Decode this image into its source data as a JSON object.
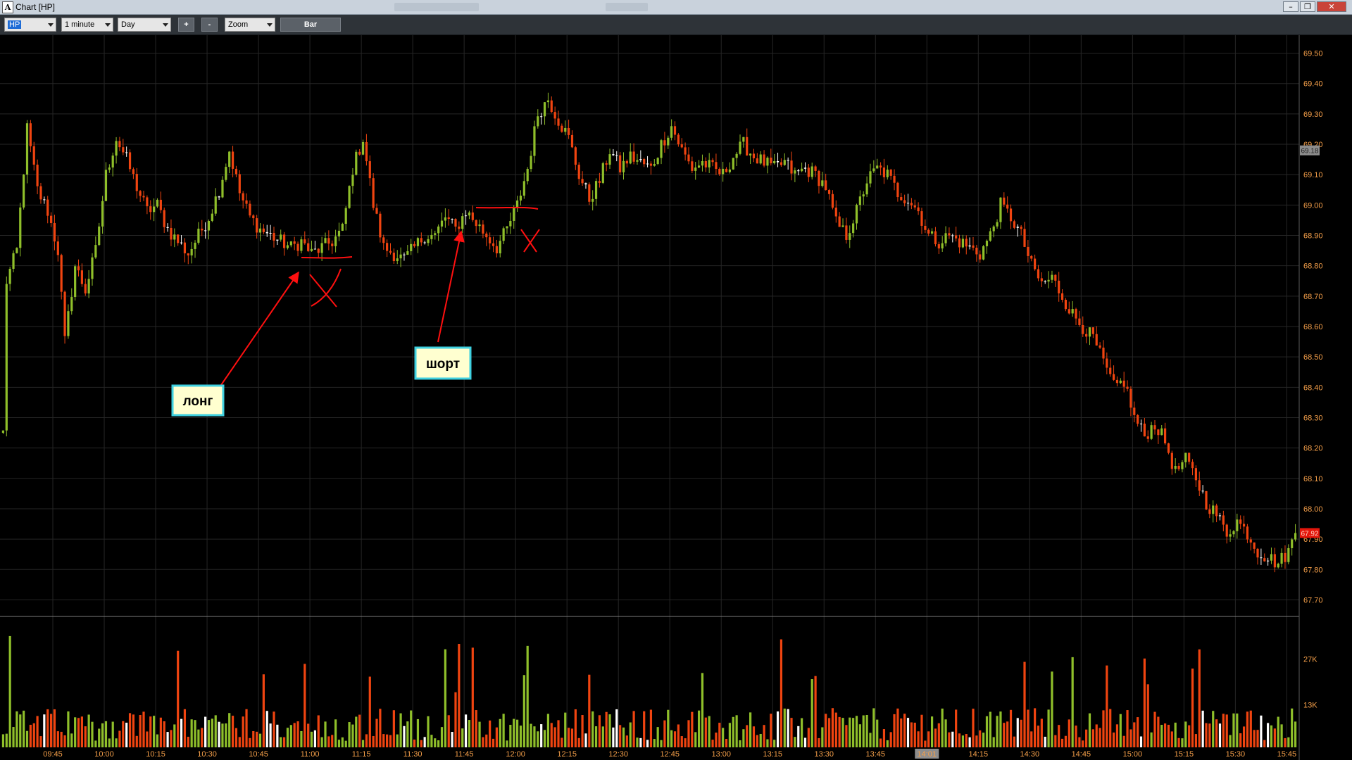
{
  "window": {
    "title": "Chart [HP]",
    "app_icon": "A",
    "buttons": {
      "minimize": "–",
      "restore": "❐",
      "close": "✕"
    }
  },
  "toolbar": {
    "symbol": "HP",
    "interval": "1 minute",
    "range": "Day",
    "zoom_in": "+",
    "zoom_out": "-",
    "zoom": "Zoom",
    "chart_type": "Bar"
  },
  "chart_data": {
    "type": "candlestick",
    "symbol": "HP",
    "interval": "1 minute",
    "time_ticks": [
      "09:45",
      "10:00",
      "10:15",
      "10:30",
      "10:45",
      "11:00",
      "11:15",
      "11:30",
      "11:45",
      "12:00",
      "12:15",
      "12:30",
      "12:45",
      "13:00",
      "13:15",
      "13:30",
      "13:45",
      "14:01",
      "14:15",
      "14:30",
      "14:45",
      "15:00",
      "15:15",
      "15:30",
      "15:45"
    ],
    "price_ticks": [
      "69.50",
      "69.40",
      "69.30",
      "69.20",
      "69.10",
      "69.00",
      "68.90",
      "68.80",
      "68.70",
      "68.60",
      "68.50",
      "68.40",
      "68.30",
      "68.20",
      "68.10",
      "68.00",
      "67.90",
      "67.80",
      "67.70"
    ],
    "ylim": [
      67.65,
      69.55
    ],
    "volume_ticks": [
      "27K",
      "13K"
    ],
    "volume_tick_values": [
      27000,
      13000
    ],
    "volume_ylim": [
      0,
      40000
    ],
    "current_price_label": "67.92",
    "current_price": 67.92,
    "marker_label": "69.18",
    "marker_price": 69.18,
    "highlighted_time": "14:01",
    "colors": {
      "up": "#8fbf2a",
      "down": "#f04410",
      "neutral": "#ffffff",
      "price_tag": "#e4160b",
      "marker_tag": "#8d8d8d",
      "axis_text": "#f6a04a",
      "annotation": "#ff1010"
    },
    "price_path": [
      [
        0,
        68.25
      ],
      [
        1,
        68.75
      ],
      [
        4,
        68.85
      ],
      [
        7,
        69.25
      ],
      [
        10,
        69.05
      ],
      [
        13,
        68.98
      ],
      [
        16,
        68.85
      ],
      [
        18,
        68.55
      ],
      [
        21,
        68.8
      ],
      [
        24,
        68.72
      ],
      [
        27,
        68.85
      ],
      [
        30,
        69.1
      ],
      [
        33,
        69.22
      ],
      [
        36,
        69.15
      ],
      [
        39,
        69.06
      ],
      [
        42,
        68.98
      ],
      [
        45,
        69.0
      ],
      [
        48,
        68.92
      ],
      [
        51,
        68.88
      ],
      [
        54,
        68.84
      ],
      [
        57,
        68.9
      ],
      [
        60,
        68.96
      ],
      [
        63,
        69.05
      ],
      [
        66,
        69.18
      ],
      [
        69,
        69.04
      ],
      [
        72,
        68.96
      ],
      [
        75,
        68.92
      ],
      [
        78,
        68.9
      ],
      [
        81,
        68.88
      ],
      [
        84,
        68.86
      ],
      [
        87,
        68.88
      ],
      [
        90,
        68.84
      ],
      [
        93,
        68.86
      ],
      [
        96,
        68.88
      ],
      [
        99,
        68.92
      ],
      [
        102,
        69.12
      ],
      [
        105,
        69.22
      ],
      [
        108,
        69.0
      ],
      [
        111,
        68.86
      ],
      [
        114,
        68.84
      ],
      [
        117,
        68.82
      ],
      [
        120,
        68.86
      ],
      [
        123,
        68.9
      ],
      [
        126,
        68.9
      ],
      [
        129,
        68.96
      ],
      [
        132,
        68.92
      ],
      [
        135,
        68.98
      ],
      [
        138,
        68.94
      ],
      [
        141,
        68.9
      ],
      [
        144,
        68.86
      ],
      [
        147,
        68.92
      ],
      [
        150,
        69.0
      ],
      [
        153,
        69.12
      ],
      [
        156,
        69.3
      ],
      [
        159,
        69.35
      ],
      [
        162,
        69.28
      ],
      [
        165,
        69.22
      ],
      [
        168,
        69.1
      ],
      [
        171,
        69.02
      ],
      [
        174,
        69.08
      ],
      [
        177,
        69.18
      ],
      [
        180,
        69.12
      ],
      [
        183,
        69.16
      ],
      [
        186,
        69.14
      ],
      [
        189,
        69.12
      ],
      [
        192,
        69.2
      ],
      [
        195,
        69.26
      ],
      [
        198,
        69.18
      ],
      [
        201,
        69.12
      ],
      [
        204,
        69.14
      ],
      [
        207,
        69.12
      ],
      [
        210,
        69.1
      ],
      [
        213,
        69.16
      ],
      [
        216,
        69.2
      ],
      [
        219,
        69.16
      ],
      [
        222,
        69.14
      ],
      [
        225,
        69.12
      ],
      [
        228,
        69.14
      ],
      [
        231,
        69.1
      ],
      [
        234,
        69.12
      ],
      [
        237,
        69.1
      ],
      [
        240,
        69.06
      ],
      [
        243,
        68.94
      ],
      [
        246,
        68.9
      ],
      [
        249,
        68.98
      ],
      [
        252,
        69.08
      ],
      [
        255,
        69.12
      ],
      [
        258,
        69.1
      ],
      [
        261,
        69.04
      ],
      [
        264,
        69.02
      ],
      [
        267,
        68.98
      ],
      [
        270,
        68.9
      ],
      [
        273,
        68.88
      ],
      [
        276,
        68.9
      ],
      [
        279,
        68.88
      ],
      [
        282,
        68.86
      ],
      [
        285,
        68.84
      ],
      [
        288,
        68.9
      ],
      [
        291,
        69.0
      ],
      [
        294,
        68.96
      ],
      [
        297,
        68.9
      ],
      [
        300,
        68.8
      ],
      [
        303,
        68.74
      ],
      [
        306,
        68.76
      ],
      [
        309,
        68.7
      ],
      [
        312,
        68.64
      ],
      [
        315,
        68.6
      ],
      [
        318,
        68.56
      ],
      [
        321,
        68.48
      ],
      [
        324,
        68.4
      ],
      [
        327,
        68.42
      ],
      [
        330,
        68.3
      ],
      [
        333,
        68.24
      ],
      [
        336,
        68.28
      ],
      [
        339,
        68.22
      ],
      [
        342,
        68.12
      ],
      [
        345,
        68.16
      ],
      [
        348,
        68.1
      ],
      [
        351,
        68.02
      ],
      [
        354,
        67.98
      ],
      [
        357,
        67.92
      ],
      [
        360,
        67.96
      ],
      [
        363,
        67.92
      ],
      [
        366,
        67.86
      ],
      [
        369,
        67.84
      ],
      [
        372,
        67.82
      ],
      [
        375,
        67.86
      ],
      [
        377,
        67.92
      ]
    ],
    "annotations": [
      {
        "label": "лонг"
      },
      {
        "label": "шорт"
      }
    ]
  }
}
